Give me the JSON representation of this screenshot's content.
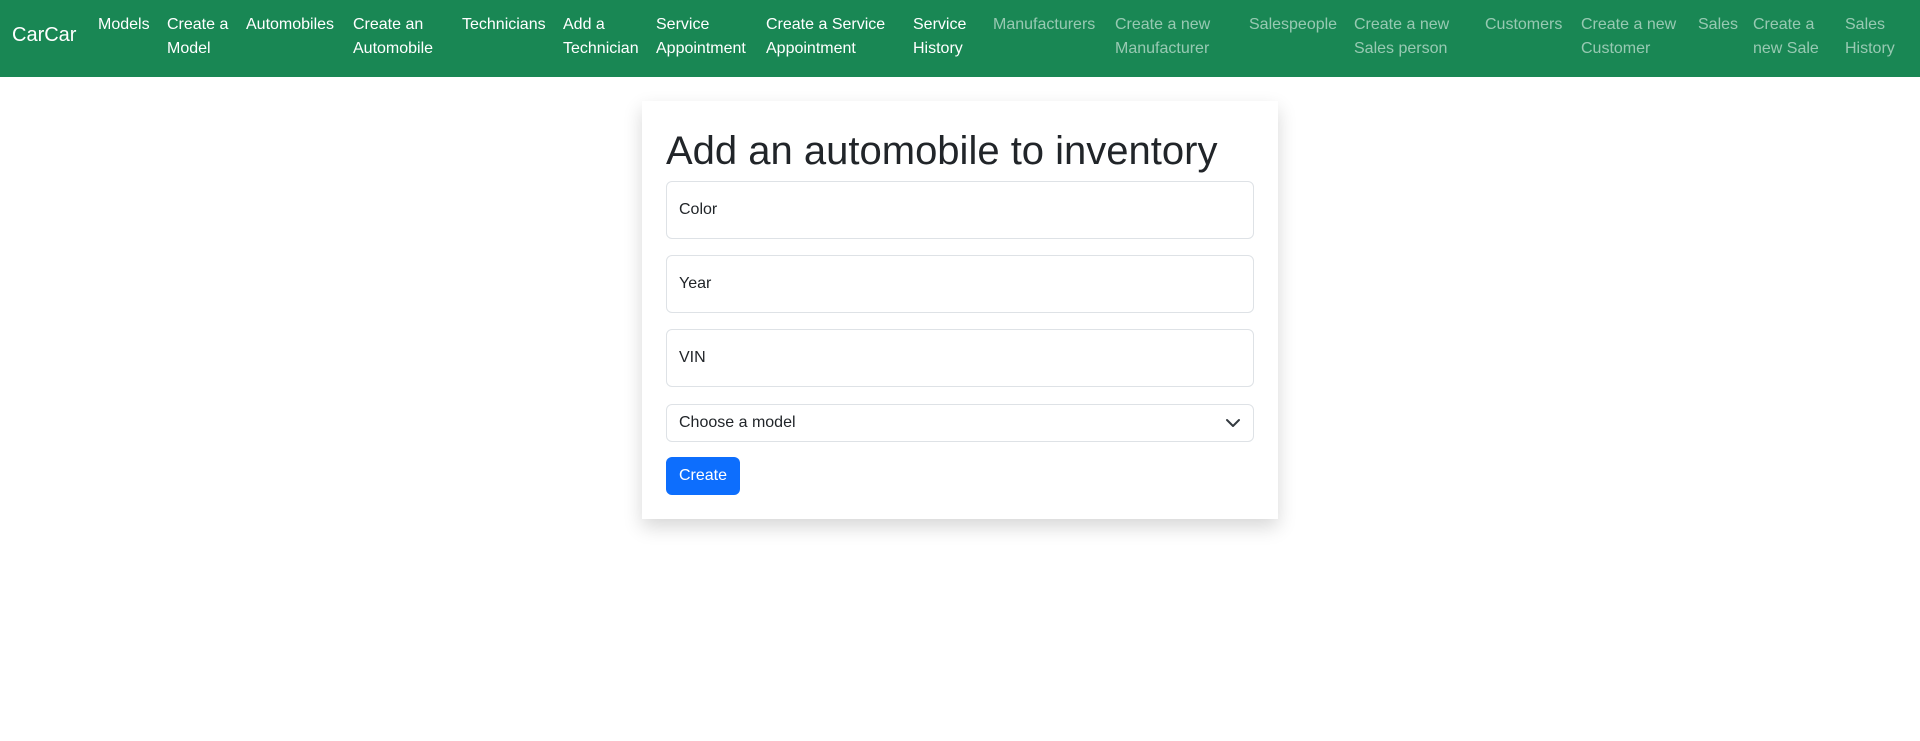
{
  "navbar": {
    "brand": "CarCar",
    "links": [
      {
        "line1": "Models",
        "line2": ""
      },
      {
        "line1": "Create a",
        "line2": "Model"
      },
      {
        "line1": "Automobiles",
        "line2": ""
      },
      {
        "line1": "Create an",
        "line2": "Automobile"
      },
      {
        "line1": "Technicians",
        "line2": ""
      },
      {
        "line1": "Add a",
        "line2": "Technician"
      },
      {
        "line1": "Service",
        "line2": "Appointment"
      },
      {
        "line1": "Create a Service",
        "line2": "Appointment"
      },
      {
        "line1": "Service",
        "line2": "History"
      },
      {
        "line1": "Manufacturers",
        "line2": ""
      },
      {
        "line1": "Create a new",
        "line2": "Manufacturer"
      },
      {
        "line1": "Salespeople",
        "line2": ""
      },
      {
        "line1": "Create a new",
        "line2": "Sales person"
      },
      {
        "line1": "Customers",
        "line2": ""
      },
      {
        "line1": "Create a new",
        "line2": "Customer"
      },
      {
        "line1": "Sales",
        "line2": ""
      },
      {
        "line1": "Create a",
        "line2": "new Sale"
      },
      {
        "line1": "Sales",
        "line2": "History"
      }
    ]
  },
  "form": {
    "title": "Add an automobile to inventory",
    "color_placeholder": "Color",
    "year_placeholder": "Year",
    "vin_placeholder": "VIN",
    "model_select": "Choose a model",
    "submit_label": "Create"
  },
  "colors": {
    "navbar_bg": "#198754",
    "primary_button": "#0d6efd"
  },
  "icons": {
    "select_arrow": "chevron-down-icon"
  }
}
